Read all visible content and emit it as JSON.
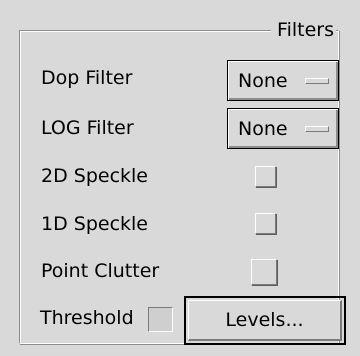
{
  "group": {
    "title": "Filters"
  },
  "dop_filter": {
    "label": "Dop Filter",
    "value": "None"
  },
  "log_filter": {
    "label": "LOG Filter",
    "value": "None"
  },
  "speckle_2d": {
    "label": "2D Speckle",
    "checked": false
  },
  "speckle_1d": {
    "label": "1D Speckle",
    "checked": false
  },
  "point_clutter": {
    "label": "Point Clutter",
    "checked": false
  },
  "threshold": {
    "label": "Threshold",
    "checked": false
  },
  "levels_button": {
    "label": "Levels..."
  }
}
